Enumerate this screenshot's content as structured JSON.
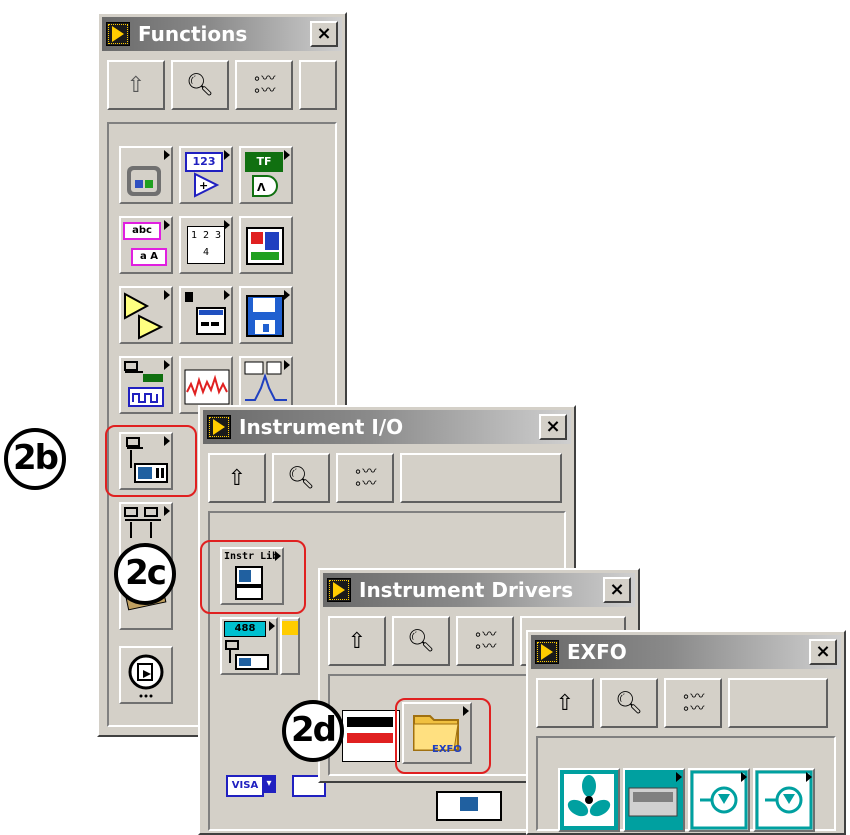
{
  "functions_palette": {
    "title": "Functions",
    "close_label": "×"
  },
  "instrument_io_palette": {
    "title": "Instrument I/O",
    "close_label": "×",
    "instr_lib_label": "Instr Lib",
    "gpib_label": "488",
    "visa_label": "VISA"
  },
  "instrument_drivers_palette": {
    "title": "Instrument Drivers",
    "close_label": "×",
    "folder_label": "EXFO"
  },
  "exfo_palette": {
    "title": "EXFO",
    "close_label": "×"
  },
  "callouts": {
    "step_2b": "2b",
    "step_2c": "2c",
    "step_2d": "2d"
  },
  "icon_text": {
    "numeric": "123",
    "boolean": "TF",
    "string": "abc",
    "array": "1 2 3 4"
  },
  "colors": {
    "highlight": "#e02020",
    "titlebar": "#8a8a8a",
    "teal": "#00a0a0"
  }
}
